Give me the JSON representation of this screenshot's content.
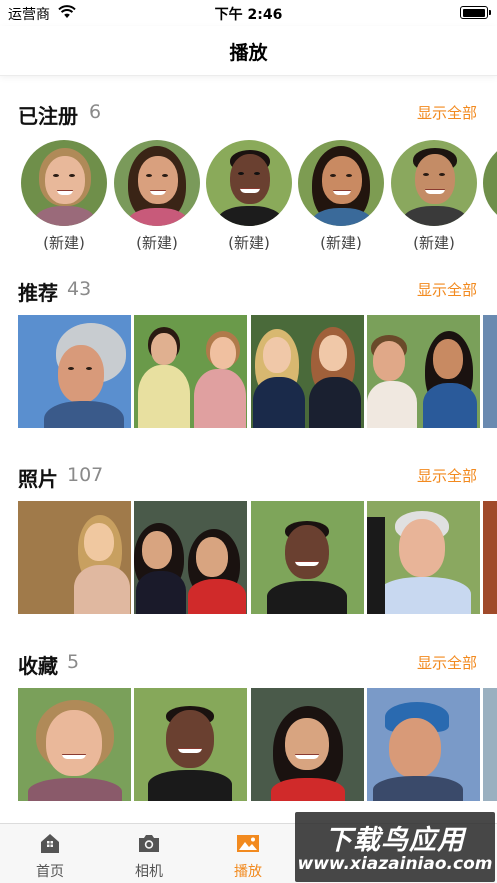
{
  "status_bar": {
    "carrier": "运营商",
    "time": "下午 2:46",
    "battery_percent": 100
  },
  "nav": {
    "title": "播放"
  },
  "registered": {
    "title": "已注册",
    "count": "6",
    "show_all": "显示全部",
    "people": [
      {
        "label": "(新建)"
      },
      {
        "label": "(新建)"
      },
      {
        "label": "(新建)"
      },
      {
        "label": "(新建)"
      },
      {
        "label": "(新建)"
      }
    ]
  },
  "recommended": {
    "title": "推荐",
    "count": "43",
    "show_all": "显示全部"
  },
  "photos": {
    "title": "照片",
    "count": "107",
    "show_all": "显示全部"
  },
  "favorites": {
    "title": "收藏",
    "count": "5",
    "show_all": "显示全部"
  },
  "tab_bar": {
    "tabs": [
      {
        "label": "首页",
        "icon": "home-icon",
        "active": false
      },
      {
        "label": "相机",
        "icon": "camera-icon",
        "active": false
      },
      {
        "label": "播放",
        "icon": "photo-gallery-icon",
        "active": true
      }
    ]
  },
  "watermark": {
    "line1": "下载鸟应用",
    "line2": "www.xiazainiao.com"
  },
  "colors": {
    "accent": "#f28a1f",
    "count_gray": "#8a8a8a",
    "tab_inactive": "#555555"
  }
}
